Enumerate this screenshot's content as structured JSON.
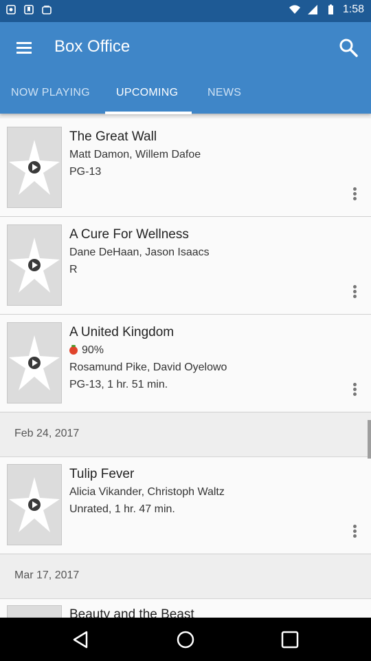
{
  "status_bar": {
    "time": "1:58"
  },
  "app_bar": {
    "title": "Box Office",
    "menu_icon": "hamburger-menu-icon",
    "search_icon": "search-icon"
  },
  "tabs": [
    {
      "label": "NOW PLAYING",
      "active": false
    },
    {
      "label": "UPCOMING",
      "active": true
    },
    {
      "label": "NEWS",
      "active": false
    }
  ],
  "movies": [
    {
      "title": "The Great Wall",
      "cast": "Matt Damon, Willem Dafoe",
      "details": "PG-13"
    },
    {
      "title": "A Cure For Wellness",
      "cast": "Dane DeHaan, Jason Isaacs",
      "details": "R"
    },
    {
      "title": "A United Kingdom",
      "rating": "90%",
      "cast": "Rosamund Pike, David Oyelowo",
      "details": "PG-13, 1 hr. 51 min."
    },
    {
      "title": "Tulip Fever",
      "cast": "Alicia Vikander, Christoph Waltz",
      "details": "Unrated, 1 hr. 47 min."
    },
    {
      "title": "Beauty and the Beast"
    }
  ],
  "date_headers": [
    "Feb 24, 2017",
    "Mar 17, 2017"
  ],
  "colors": {
    "status_bar": "#1e5a95",
    "app_bar": "#3f86c8",
    "tomato": "#e0442b"
  }
}
